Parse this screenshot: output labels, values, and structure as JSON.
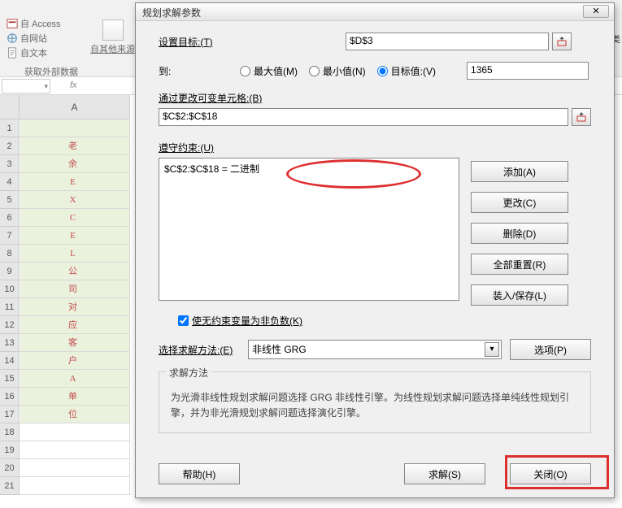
{
  "ribbon": {
    "ext_items": [
      {
        "icon": "access",
        "label": "自 Access"
      },
      {
        "icon": "web",
        "label": "自网站"
      },
      {
        "icon": "text",
        "label": "自文本"
      }
    ],
    "other_source": "自其他来源",
    "group_label": "获取外部数据",
    "right_fragment": "分类"
  },
  "fbar": {
    "fx": "fx"
  },
  "grid": {
    "colA": "A",
    "rows": 21,
    "letters": [
      "老",
      "余",
      "E",
      "X",
      "C",
      "E",
      "L",
      "公",
      "司",
      "对",
      "应",
      "客",
      "户",
      "A",
      "单",
      "位"
    ]
  },
  "dialog": {
    "title": "规划求解参数",
    "close": "✕",
    "target_label": "设置目标:(T)",
    "target_value": "$D$3",
    "to_label": "到:",
    "opt_max": "最大值(M)",
    "opt_min": "最小值(N)",
    "opt_value": "目标值:(V)",
    "target_num": "1365",
    "var_label": "通过更改可变单元格:(B)",
    "var_value": "$C$2:$C$18",
    "constraints_label": "遵守约束:(U)",
    "constraint_item": "$C$2:$C$18 = 二进制",
    "btn_add": "添加(A)",
    "btn_change": "更改(C)",
    "btn_delete": "删除(D)",
    "btn_reset": "全部重置(R)",
    "btn_loadsave": "装入/保存(L)",
    "chk_nonneg": "使无约束变量为非负数(K)",
    "method_label": "选择求解方法:(E)",
    "method_value": "非线性 GRG",
    "btn_options": "选项(P)",
    "desc_title": "求解方法",
    "desc_text": "为光滑非线性规划求解问题选择 GRG 非线性引擎。为线性规划求解问题选择单纯线性规划引擎，并为非光滑规划求解问题选择演化引擎。",
    "btn_help": "帮助(H)",
    "btn_solve": "求解(S)",
    "btn_closedlg": "关闭(O)"
  }
}
